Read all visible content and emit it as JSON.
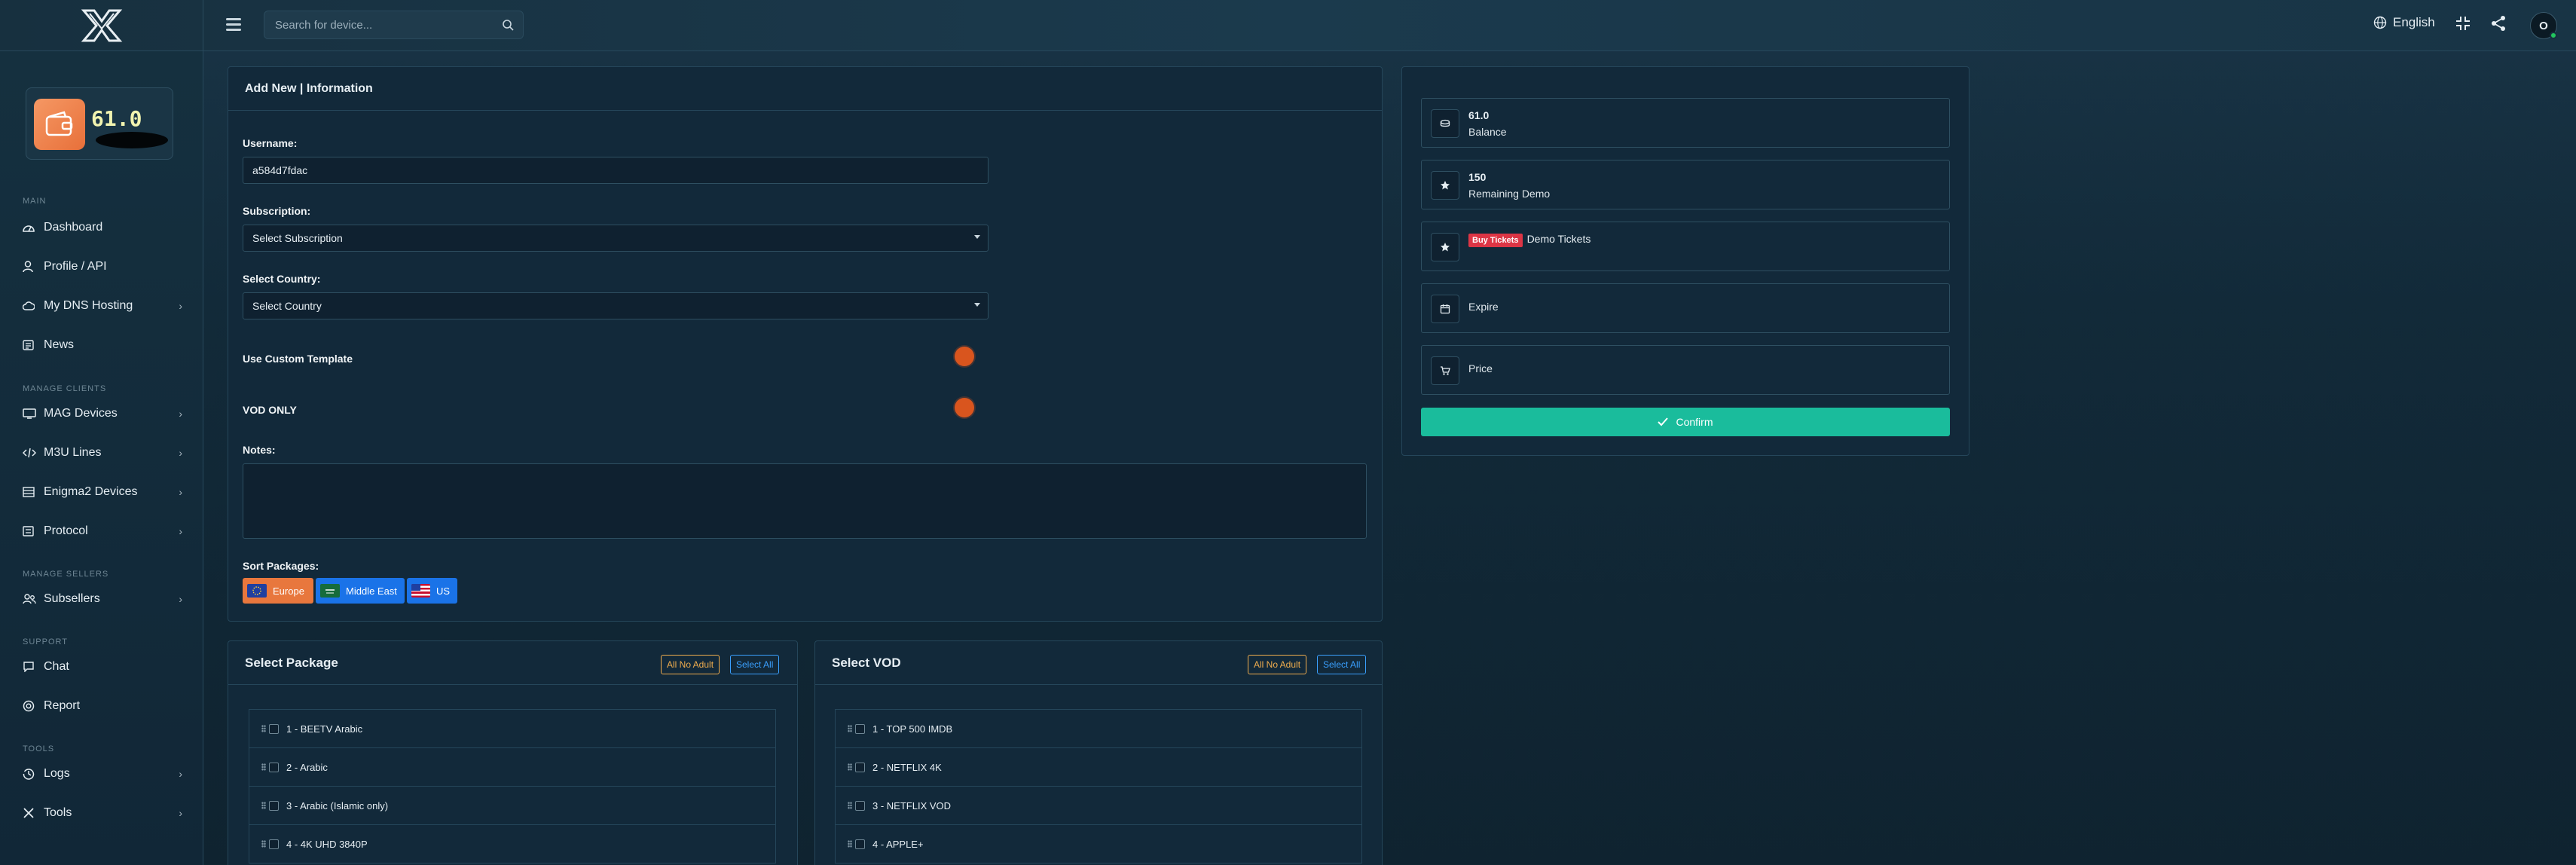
{
  "header": {
    "search_placeholder": "Search for device...",
    "language": "English",
    "avatar_initial": "O"
  },
  "sidebar": {
    "balance_display": "61.0",
    "sections": {
      "main": "MAIN",
      "manage_clients": "MANAGE CLIENTS",
      "manage_sellers": "MANAGE SELLERS",
      "support": "SUPPORT",
      "tools": "TOOLS"
    },
    "items": {
      "dashboard": "Dashboard",
      "profile": "Profile / API",
      "dns": "My DNS Hosting",
      "news": "News",
      "mag": "MAG Devices",
      "m3u": "M3U Lines",
      "enigma": "Enigma2 Devices",
      "protocol": "Protocol",
      "subsellers": "Subsellers",
      "chat": "Chat",
      "report": "Report",
      "logs": "Logs",
      "tools": "Tools"
    }
  },
  "form": {
    "title": "Add New | Information",
    "username_label": "Username:",
    "username_value": "a584d7fdac",
    "subscription_label": "Subscription:",
    "subscription_value": "Select Subscription",
    "country_label": "Select Country:",
    "country_value": "Select Country",
    "custom_template_label": "Use Custom Template",
    "vod_only_label": "VOD ONLY",
    "notes_label": "Notes:",
    "sort_label": "Sort Packages:",
    "sort_packages": [
      "Europe",
      "Middle East",
      "US"
    ]
  },
  "summary": {
    "balance_value": "61.0",
    "balance_label": "Balance",
    "demo_value": "150",
    "demo_label": "Remaining Demo",
    "buy_tickets": "Buy Tickets",
    "demo_tickets": "Demo Tickets",
    "expire_label": "Expire",
    "price_label": "Price",
    "confirm_label": "Confirm"
  },
  "packages": {
    "title": "Select Package",
    "btn_no_adult": "All No Adult",
    "btn_select_all": "Select All",
    "items": [
      "1 - BEETV Arabic",
      "2 - Arabic",
      "3 - Arabic (Islamic only)",
      "4 - 4K UHD 3840P"
    ]
  },
  "vod": {
    "title": "Select VOD",
    "btn_no_adult": "All No Adult",
    "btn_select_all": "Select All",
    "items": [
      "1 - TOP 500 IMDB",
      "2 - NETFLIX 4K",
      "3 - NETFLIX VOD",
      "4 - APPLE+"
    ]
  },
  "colors": {
    "accent_teal": "#1abc9c",
    "toggle_orange": "#d9551e",
    "europe_btn": "#e8773d",
    "region_btn_blue": "#1a73e8",
    "buy_red": "#dc3545"
  }
}
